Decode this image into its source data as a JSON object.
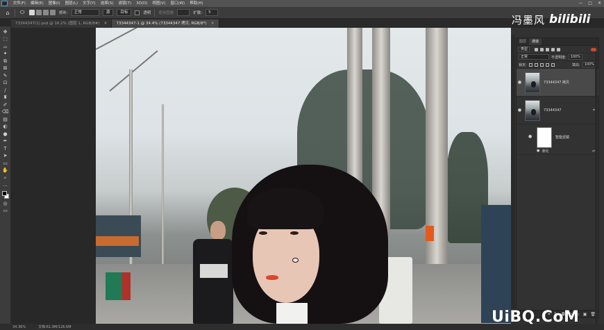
{
  "menubar": {
    "items": [
      "文件(F)",
      "编辑(E)",
      "图像(I)",
      "图层(L)",
      "文字(Y)",
      "选择(S)",
      "滤镜(T)",
      "3D(D)",
      "视图(V)",
      "窗口(W)",
      "帮助(H)"
    ],
    "window_controls": [
      "—",
      "□",
      "✕"
    ]
  },
  "options": {
    "source_label": "源",
    "mode_label": "修补:",
    "mode_value": "正常",
    "source_btn": "源",
    "dest_label": "目标",
    "transparent_label": "透明",
    "use_pattern_label": "使用图案",
    "diffusion_label": "扩散:",
    "diffusion_value": "5"
  },
  "logo": {
    "cn": "冯墨风",
    "bili": "bilibili"
  },
  "tabs": [
    {
      "label": "73344347(1).psd @ 16.2% (图层 1, RGB/8#)",
      "close": "×"
    },
    {
      "label": "73344347-1 @ 34.4% (73344347 拷贝, RGB/8*)",
      "close": "×"
    }
  ],
  "toolbar": {
    "tools": [
      "✥",
      "⬚",
      "⌓",
      "✦",
      "⧉",
      "⊠",
      "✎",
      "⊡",
      "/",
      "♜",
      "✐",
      "⌫",
      "▤",
      "◐",
      "●",
      "✒",
      "T",
      "➤",
      "▭",
      "✋",
      "⌕",
      "…"
    ]
  },
  "layers": {
    "tabs": [
      "图层",
      "通道",
      "路径"
    ],
    "filter_label": "类型",
    "blend_mode": "正常",
    "opacity_label": "不透明度:",
    "opacity_value": "100%",
    "lock_label": "锁定:",
    "fill_label": "填充:",
    "fill_value": "100%",
    "items": [
      {
        "name": "73344347 拷贝",
        "eye": "●"
      },
      {
        "name": "73344347",
        "eye": "●",
        "link": "⚭"
      }
    ],
    "mask_label": "智能滤镜",
    "fx_label": "液化",
    "fx_ctrl": "⇌",
    "bottom_icons": [
      "⚭",
      "fx",
      "◘",
      "◐",
      "▭",
      "▣",
      "🗑"
    ]
  },
  "status": {
    "zoom": "34.36%",
    "doc": "文档:61.9M/126.6M"
  },
  "watermark": "UiBQ.CoM",
  "colors": {
    "accent": "#31a8ff",
    "menubar": "#535353",
    "panel": "#323232",
    "canvas": "#282828"
  }
}
